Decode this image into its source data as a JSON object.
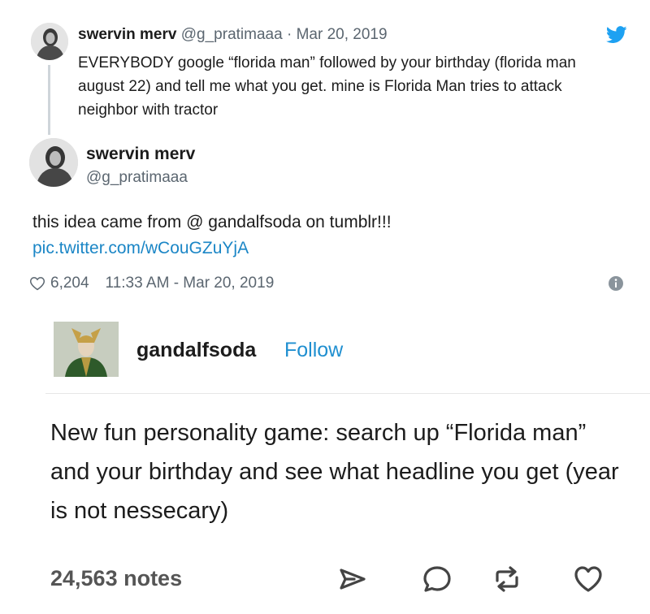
{
  "reply_tweet": {
    "name": "swervin merv",
    "handle": "@g_pratimaaa",
    "separator": "·",
    "date": "Mar 20, 2019",
    "text": "EVERYBODY google “florida man” followed by your birthday (florida man august 22) and tell me what you get. mine is Florida Man tries to attack neighbor with tractor"
  },
  "main_tweet": {
    "name": "swervin merv",
    "handle": "@g_pratimaaa",
    "text": "this idea came from @ gandalfsoda on tumblr!!!",
    "link": "pic.twitter.com/wCouGZuYjA",
    "likes": "6,204",
    "timestamp": "11:33 AM - Mar 20, 2019"
  },
  "tumblr_post": {
    "username": "gandalfsoda",
    "follow_label": "Follow",
    "body": "New fun personality game: search up “Florida man” and your birthday and see what headline you get (year is not nessecary)",
    "notes": "24,563 notes"
  },
  "icons": {
    "brand": "twitter-bird-icon",
    "info": "info-icon",
    "like_small": "heart-outline-icon",
    "actions": [
      "share-icon",
      "reply-icon",
      "reblog-icon",
      "heart-icon"
    ]
  },
  "colors": {
    "twitter_blue": "#1da1f2",
    "link_blue": "#1b86c6",
    "follow_blue": "#1f8fd0",
    "muted_text": "#5b6670"
  }
}
